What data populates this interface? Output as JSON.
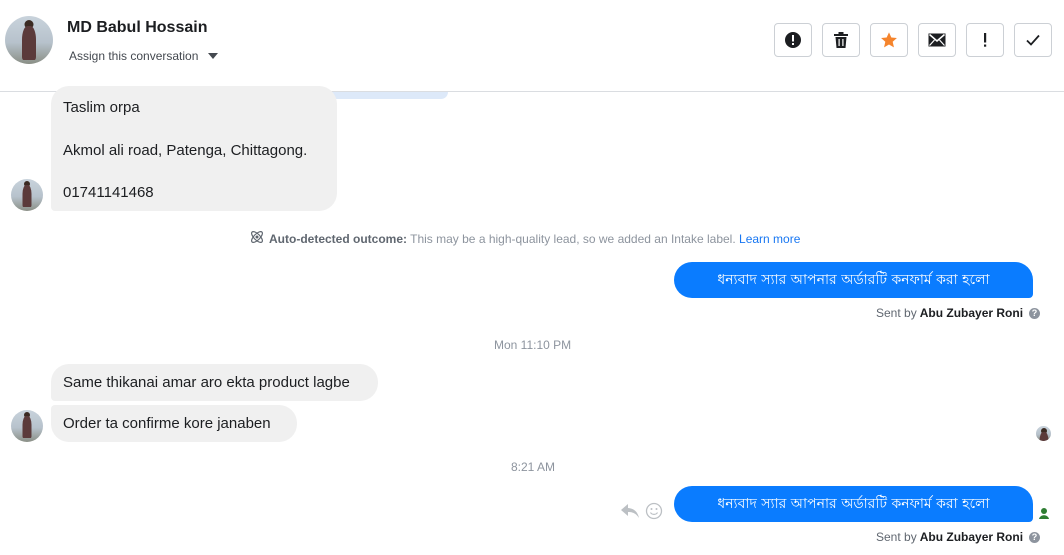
{
  "header": {
    "name": "MD Babul Hossain",
    "assign_label": "Assign this conversation",
    "actions": [
      {
        "icon": "alert-circle-icon"
      },
      {
        "icon": "trash-icon"
      },
      {
        "icon": "star-icon",
        "color": "#f5842c"
      },
      {
        "icon": "envelope-icon"
      },
      {
        "icon": "exclamation-icon"
      },
      {
        "icon": "checkmark-icon"
      }
    ]
  },
  "messages": {
    "address_line1": "Taslim orpa",
    "address_line2": "Akmol ali road, Patenga, Chittagong.",
    "address_line3": "01741141468",
    "outcome_bold": "Auto-detected outcome:",
    "outcome_text": "This may be a high-quality lead, so we added an Intake label.",
    "outcome_link": "Learn more",
    "reply1": "ধন্যবাদ স্যার আপনার অর্ডারটি কনফার্ম করা হলো",
    "sent_by_prefix": "Sent by",
    "sent_by_name": "Abu Zubayer Roni",
    "time1": "Mon 11:10 PM",
    "incoming1": "Same thikanai amar aro ekta product lagbe",
    "incoming2": "Order ta confirme kore janaben",
    "time2": "8:21 AM",
    "reply2": "ধন্যবাদ স্যার আপনার অর্ডারটি কনফার্ম করা হলো"
  },
  "colors": {
    "outgoing_bubble": "#0a7cff",
    "incoming_bubble": "#f0f0f0",
    "link": "#1877f2"
  }
}
